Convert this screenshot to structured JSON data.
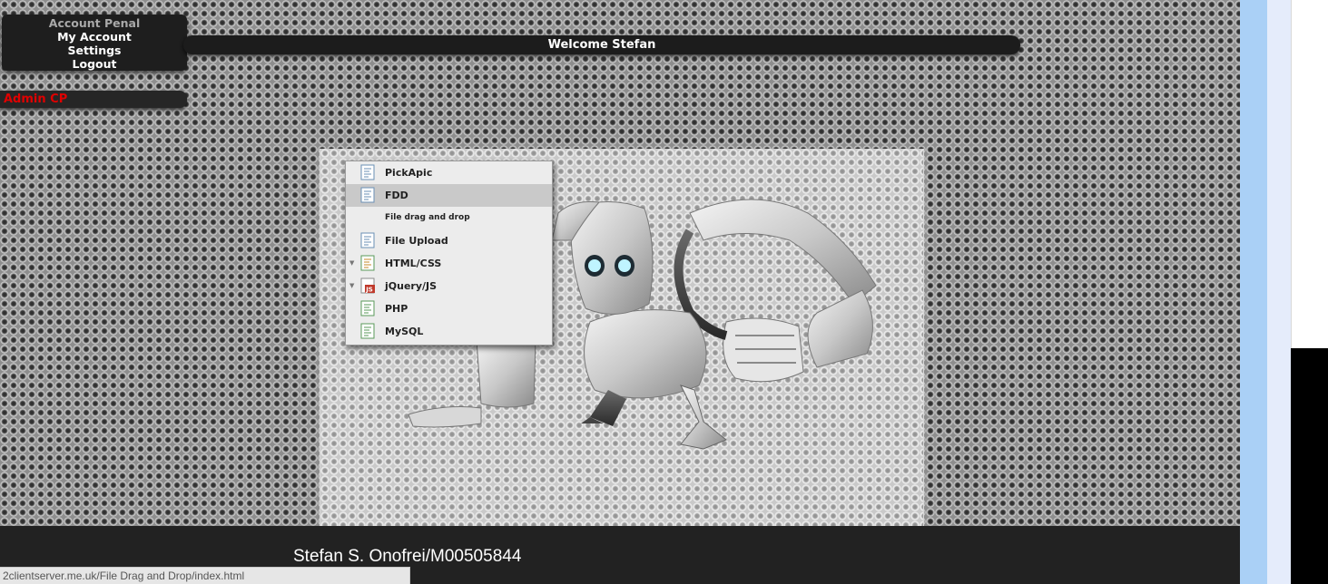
{
  "account_panel": {
    "title": "Account Penal",
    "links": [
      "My Account",
      "Settings",
      "Logout"
    ]
  },
  "welcome": "Welcome Stefan",
  "admin": "Admin CP",
  "menu": {
    "items": [
      {
        "label": "PickApic",
        "icon": "page-icon"
      },
      {
        "label": "FDD",
        "icon": "page-icon"
      },
      {
        "label": "File Upload",
        "icon": "page-icon"
      },
      {
        "label": "HTML/CSS",
        "icon": "page-icon"
      },
      {
        "label": "jQuery/JS",
        "icon": "js-file-icon"
      },
      {
        "label": "PHP",
        "icon": "page-icon"
      },
      {
        "label": "MySQL",
        "icon": "page-icon"
      }
    ],
    "fdd_subtext": "File drag and drop"
  },
  "footer": "Stefan S. Onofrei/M00505844",
  "status_url": "2clientserver.me.uk/File Drag and Drop/index.html"
}
